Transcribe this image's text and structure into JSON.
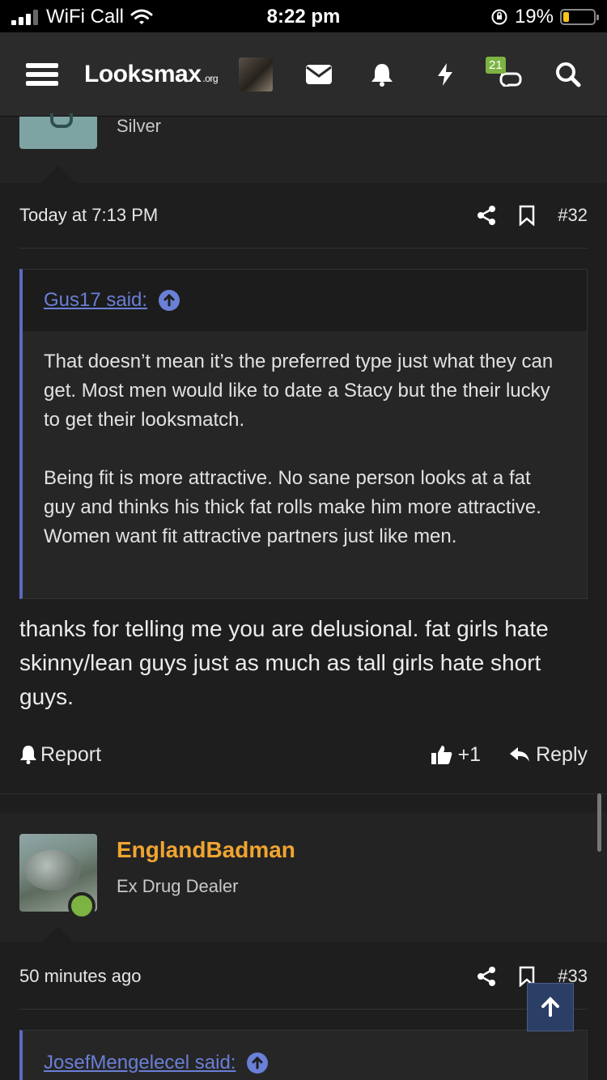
{
  "status_bar": {
    "carrier": "WiFi Call",
    "time": "8:22 pm",
    "battery": "19%",
    "battery_level": 0.19
  },
  "nav": {
    "logo_main": "Looksmax",
    "logo_suffix": ".org",
    "badge_count": "21"
  },
  "prev_user": {
    "title": "Silver"
  },
  "post32": {
    "time": "Today at 7:13 PM",
    "number": "#32",
    "quote": {
      "author_link": "Gus17 said:",
      "paragraphs": [
        "That doesn’t mean it’s the preferred type just what they can get. Most men would like to date a Stacy but the their lucky to get their looksmatch.",
        "Being fit is more attractive. No sane person looks at a fat guy and thinks his thick fat rolls make him more attractive. Women want fit attractive partners just like men."
      ]
    },
    "body": "thanks for telling me you are delusional. fat girls hate skinny/lean guys just as much as tall girls hate short guys.",
    "report_label": "Report",
    "like_count": "+1",
    "reply_label": "Reply"
  },
  "next_user": {
    "name": "EnglandBadman",
    "title": "Ex Drug Dealer"
  },
  "post33": {
    "time": "50 minutes ago",
    "number": "#33",
    "quote": {
      "author_link": "JosefMengelecel said:"
    }
  }
}
